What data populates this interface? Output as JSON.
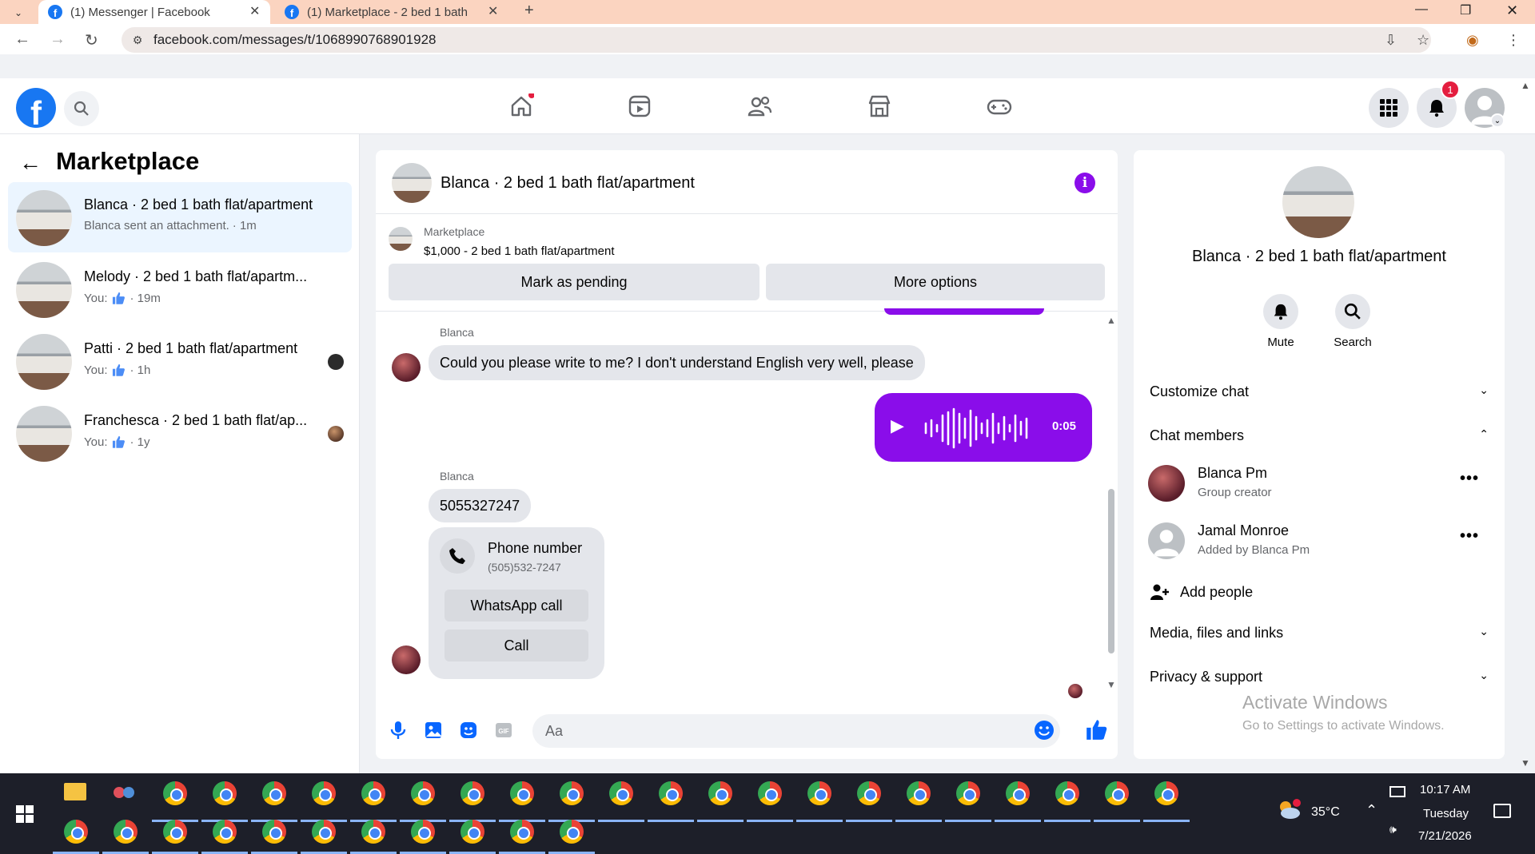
{
  "browser": {
    "tabs": [
      {
        "title": "(1) Messenger | Facebook",
        "active": true
      },
      {
        "title": "(1) Marketplace - 2 bed 1 bath",
        "active": false
      }
    ],
    "url": "facebook.com/messages/t/1068990768901928"
  },
  "fb_nav": {
    "notifications_count": "1",
    "icons": [
      "home-icon",
      "reels-icon",
      "friends-icon",
      "marketplace-icon",
      "gaming-icon"
    ]
  },
  "left_panel": {
    "title": "Marketplace",
    "conversations": [
      {
        "name": "Blanca · 2 bed 1 bath flat/apartment",
        "sub": "Blanca sent an attachment.",
        "time": "· 1m",
        "active": true,
        "you": false
      },
      {
        "name": "Melody · 2 bed 1 bath flat/apartm...",
        "sub": "You:",
        "time": "· 19m",
        "active": false,
        "you": true
      },
      {
        "name": "Patti · 2 bed 1 bath flat/apartment",
        "sub": "You:",
        "time": "· 1h",
        "active": false,
        "you": true
      },
      {
        "name": "Franchesca · 2 bed 1 bath flat/ap...",
        "sub": "You:",
        "time": "· 1y",
        "active": false,
        "you": true
      }
    ]
  },
  "chat": {
    "title": "Blanca · 2 bed 1 bath flat/apartment",
    "marketplace_label": "Marketplace",
    "listing": "$1,000 - 2 bed 1 bath flat/apartment",
    "mark_pending": "Mark as pending",
    "more_options": "More options",
    "messages": {
      "sender1": "Blanca",
      "text1": "Could you please write to me? I don't understand English very well, please",
      "voice_duration": "0:05",
      "sender2": "Blanca",
      "text2": "5055327247",
      "phone_title": "Phone number",
      "phone_value": "(505)532-7247",
      "whatsapp_call": "WhatsApp call",
      "call": "Call"
    },
    "composer_placeholder": "Aa"
  },
  "right_panel": {
    "name": "Blanca · 2 bed 1 bath flat/apartment",
    "actions": {
      "mute": "Mute",
      "search": "Search"
    },
    "sections": {
      "customize": "Customize chat",
      "members": "Chat members",
      "media": "Media, files and links",
      "privacy": "Privacy & support"
    },
    "members": [
      {
        "name": "Blanca Pm",
        "sub": "Group creator"
      },
      {
        "name": "Jamal Monroe",
        "sub": "Added by Blanca Pm"
      }
    ],
    "add_people": "Add people",
    "activate_title": "Activate Windows",
    "activate_sub": "Go to Settings to activate Windows."
  },
  "taskbar": {
    "temperature": "35°C",
    "time": "10:17 AM",
    "day": "Tuesday",
    "date": "7/21/2026"
  },
  "colors": {
    "fb_blue": "#1877f2",
    "messenger_purple": "#8a0dea",
    "tab_bar": "#fbd4c0"
  }
}
